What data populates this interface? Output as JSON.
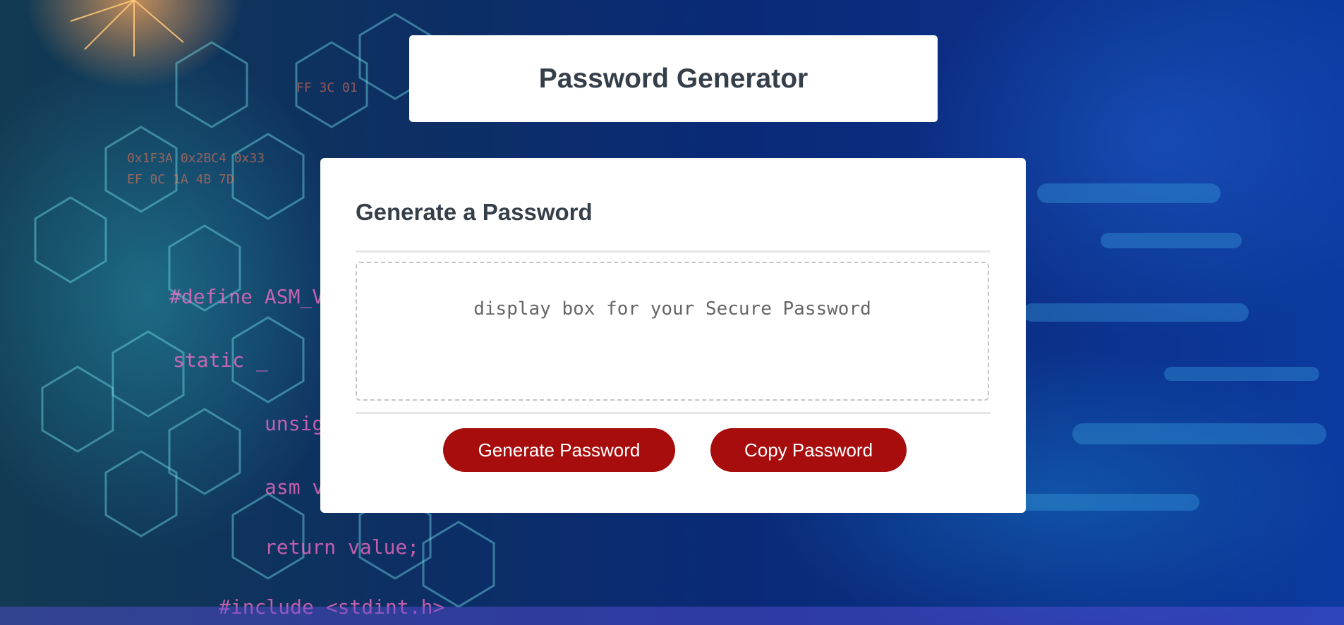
{
  "header": {
    "title": "Password Generator"
  },
  "card": {
    "heading": "Generate a Password",
    "password_field": {
      "value": "",
      "placeholder": "display box for your Secure Password"
    },
    "buttons": {
      "generate_label": "Generate Password",
      "copy_label": "Copy Password"
    }
  },
  "colors": {
    "button_bg": "#a80d0d",
    "heading_text": "#353f4a",
    "card_bg": "#ffffff"
  }
}
